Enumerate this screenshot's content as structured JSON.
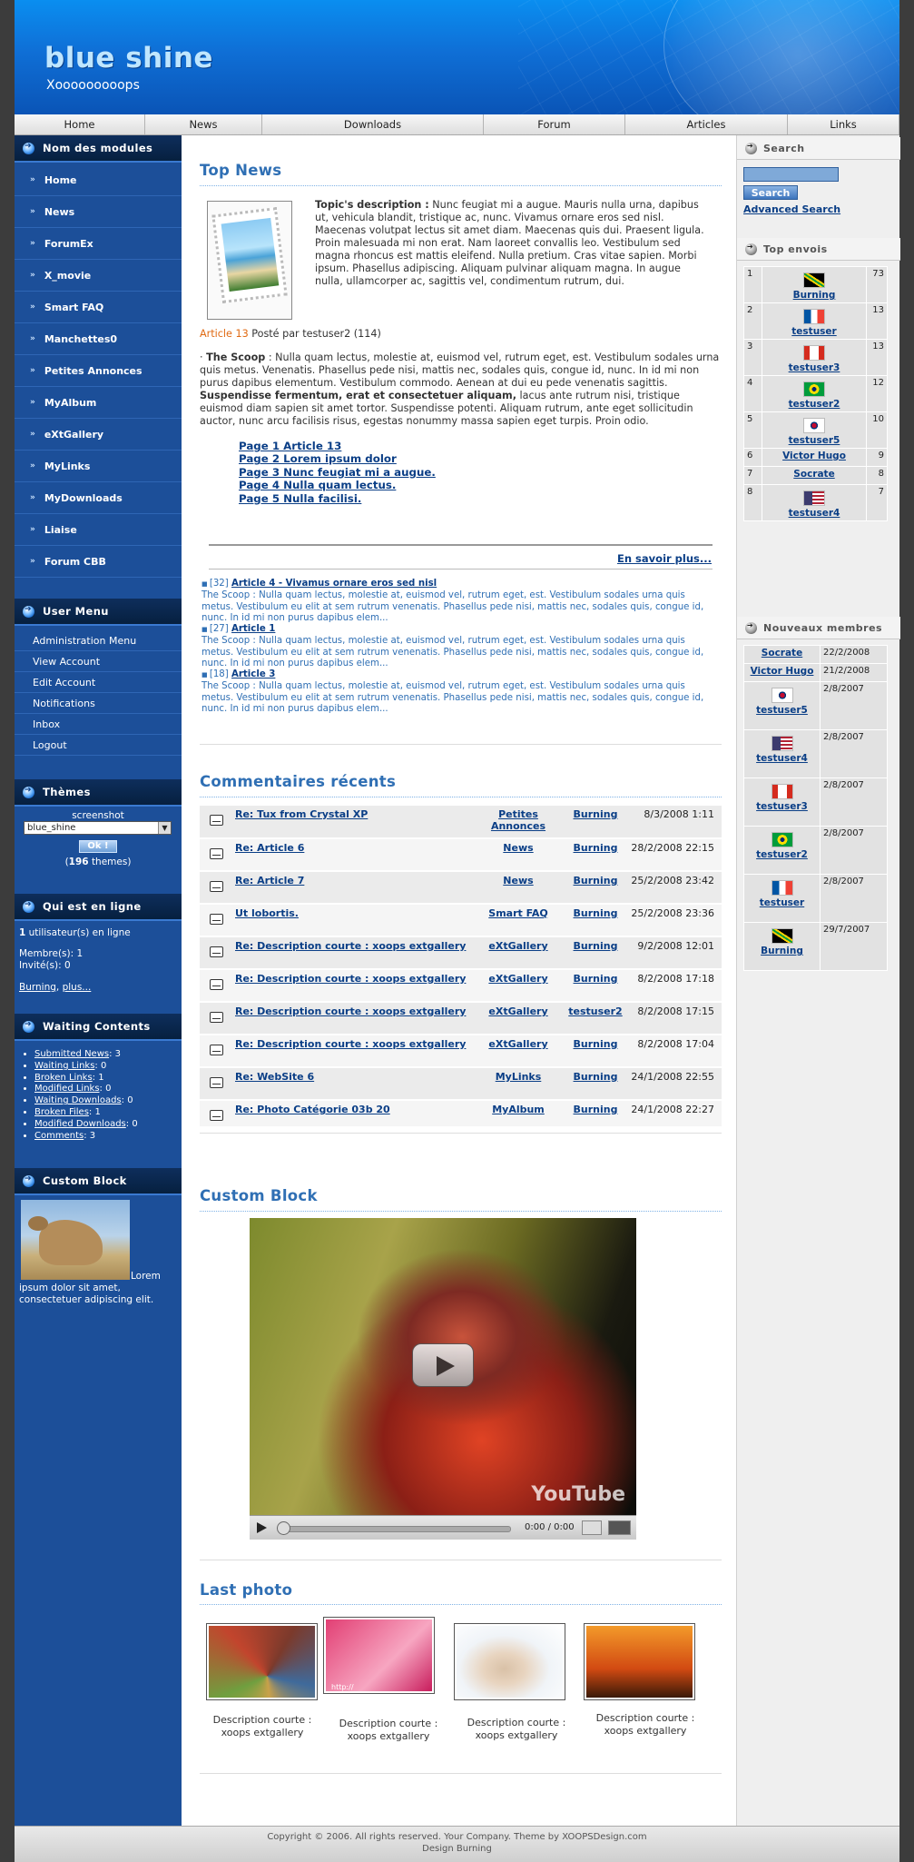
{
  "header": {
    "site_name": "blue shine",
    "slogan": "Xooooooooops"
  },
  "nav": [
    {
      "label": "Home",
      "w": 144
    },
    {
      "label": "News",
      "w": 129
    },
    {
      "label": "Downloads",
      "w": 244
    },
    {
      "label": "Forum",
      "w": 156
    },
    {
      "label": "Articles",
      "w": 179
    },
    {
      "label": "Links",
      "w": 123
    }
  ],
  "modules": {
    "title": "Nom des modules",
    "items": [
      "Home",
      "News",
      "ForumEx",
      "X_movie",
      "Smart FAQ",
      "Manchettes0",
      "Petites Annonces",
      "MyAlbum",
      "eXtGallery",
      "MyLinks",
      "MyDownloads",
      "Liaise",
      "Forum CBB"
    ]
  },
  "usermenu": {
    "title": "User Menu",
    "items": [
      "Administration Menu",
      "View Account",
      "Edit Account",
      "Notifications",
      "Inbox",
      "Logout"
    ]
  },
  "themes": {
    "title": "Thèmes",
    "screenshot_label": "screenshot",
    "selected": "blue_shine",
    "ok": "Ok !",
    "count": "196",
    "count_suffix": "themes)"
  },
  "online": {
    "title": "Qui est en ligne",
    "line1_num": "1",
    "line1": "utilisateur(s) en ligne",
    "members": "Membre(s): 1",
    "guests": "Invité(s): 0",
    "user_link": "Burning",
    "more": "plus..."
  },
  "waiting": {
    "title": "Waiting Contents",
    "items": [
      {
        "label": "Submitted News",
        "count": ": 3"
      },
      {
        "label": "Waiting Links",
        "count": ": 0"
      },
      {
        "label": "Broken Links",
        "count": ": 1"
      },
      {
        "label": "Modified Links",
        "count": ": 0"
      },
      {
        "label": "Waiting Downloads",
        "count": ": 0"
      },
      {
        "label": "Broken Files",
        "count": ": 1"
      },
      {
        "label": "Modified Downloads",
        "count": ": 0"
      },
      {
        "label": "Comments",
        "count": ": 3"
      }
    ]
  },
  "customleft": {
    "title": "Custom Block",
    "text": "Lorem ipsum dolor sit amet, consectetuer adipiscing elit."
  },
  "topnews": {
    "title": "Top News",
    "topic_label": "Topic's description :",
    "topic_text": "Nunc feugiat mi a augue. Mauris nulla urna, dapibus ut, vehicula blandit, tristique ac, nunc. Vivamus ornare eros sed nisl. Maecenas volutpat lectus sit amet diam. Maecenas quis dui. Praesent ligula. Proin malesuada mi non erat. Nam laoreet convallis leo. Vestibulum sed magna rhoncus est mattis eleifend. Nulla pretium. Cras vitae sapien. Morbi ipsum. Phasellus adipiscing. Aliquam pulvinar aliquam magna. In augue nulla, ullamcorper ac, sagittis vel, condimentum rutrum, dui.",
    "article_label": "Article 13",
    "article_meta": "Posté par testuser2 (114)",
    "scoop_label": "The Scoop",
    "scoop_text": ": Nulla quam lectus, molestie at, euismod vel, rutrum eget, est. Vestibulum sodales urna quis metus. Venenatis. Phasellus pede nisi, mattis nec, sodales quis, congue id, nunc. In id mi non purus dapibus elementum. Vestibulum commodo. Aenean at dui eu pede venenatis sagittis.",
    "scoop_bold": "Suspendisse fermentum, erat et consectetuer aliquam,",
    "scoop_text2": "lacus ante rutrum nisi, tristique euismod diam sapien sit amet tortor. Suspendisse potenti. Aliquam rutrum, ante eget sollicitudin auctor, nunc arcu facilisis risus, egestas nonummy massa sapien eget turpis. Proin odio.",
    "pages": [
      "Page 1 Article 13",
      "Page 2 Lorem ipsum dolor",
      "Page 3 Nunc feugiat mi a augue.",
      "Page 4 Nulla quam lectus.",
      "Page 5 Nulla facilisi."
    ],
    "more": "En savoir plus...",
    "list": [
      {
        "num": "[32]",
        "title": "Article 4 - Vivamus ornare eros sed nisl",
        "text": "The Scoop : Nulla quam lectus, molestie at, euismod vel, rutrum eget, est. Vestibulum sodales urna quis metus. Vestibulum eu elit at sem rutrum venenatis. Phasellus pede nisi, mattis nec, sodales quis, congue id, nunc. In id mi non purus dapibus elem..."
      },
      {
        "num": "[27]",
        "title": "Article 1",
        "text": "The Scoop : Nulla quam lectus, molestie at, euismod vel, rutrum eget, est. Vestibulum sodales urna quis metus. Vestibulum eu elit at sem rutrum venenatis. Phasellus pede nisi, mattis nec, sodales quis, congue id, nunc. In id mi non purus dapibus elem..."
      },
      {
        "num": "[18]",
        "title": "Article 3",
        "text": "The Scoop : Nulla quam lectus, molestie at, euismod vel, rutrum eget, est. Vestibulum sodales urna quis metus. Vestibulum eu elit at sem rutrum venenatis. Phasellus pede nisi, mattis nec, sodales quis, congue id, nunc. In id mi non purus dapibus elem..."
      }
    ]
  },
  "comments": {
    "title": "Commentaires récents",
    "rows": [
      {
        "title": "Re: Tux from Crystal XP",
        "module": "Petites Annonces",
        "user": "Burning",
        "date": "8/3/2008 1:11"
      },
      {
        "title": "Re: Article 6",
        "module": "News",
        "user": "Burning",
        "date": "28/2/2008 22:15"
      },
      {
        "title": "Re: Article 7",
        "module": "News",
        "user": "Burning",
        "date": "25/2/2008 23:42"
      },
      {
        "title": "Ut lobortis.",
        "module": "Smart FAQ",
        "user": "Burning",
        "date": "25/2/2008 23:36"
      },
      {
        "title": "Re: Description courte : xoops extgallery",
        "module": "eXtGallery",
        "user": "Burning",
        "date": "9/2/2008 12:01"
      },
      {
        "title": "Re: Description courte : xoops extgallery",
        "module": "eXtGallery",
        "user": "Burning",
        "date": "8/2/2008 17:18"
      },
      {
        "title": "Re: Description courte : xoops extgallery",
        "module": "eXtGallery",
        "user": "testuser2",
        "date": "8/2/2008 17:15"
      },
      {
        "title": "Re: Description courte : xoops extgallery",
        "module": "eXtGallery",
        "user": "Burning",
        "date": "8/2/2008 17:04"
      },
      {
        "title": "Re: WebSite 6",
        "module": "MyLinks",
        "user": "Burning",
        "date": "24/1/2008 22:55"
      },
      {
        "title": "Re: Photo Catégorie 03b 20",
        "module": "MyAlbum",
        "user": "Burning",
        "date": "24/1/2008 22:27"
      }
    ]
  },
  "customblock": {
    "title": "Custom Block",
    "time": "0:00 / 0:00",
    "brand": "YouTube"
  },
  "lastphoto": {
    "title": "Last photo",
    "items": [
      {
        "caption": "Description courte : xoops extgallery",
        "colors": [
          "#7b3a2c",
          "#3f6a9b",
          "#c9a14a"
        ]
      },
      {
        "caption": "Description courte : xoops extgallery",
        "colors": [
          "#e23f74",
          "#f7a6c1",
          "#c81d5c"
        ]
      },
      {
        "caption": "Description courte : xoops extgallery",
        "colors": [
          "#f0f4f8",
          "#d9c1a7",
          "#ffffff"
        ]
      },
      {
        "caption": "Description courte : xoops extgallery",
        "colors": [
          "#f39a2a",
          "#d24a12",
          "#3a1a08"
        ]
      }
    ],
    "watermark": "http://"
  },
  "search": {
    "title": "Search",
    "button": "Search",
    "advanced": "Advanced Search"
  },
  "topenvois": {
    "title": "Top envois",
    "rows": [
      {
        "rank": "1",
        "user": "Burning",
        "count": "73",
        "flag": "jm"
      },
      {
        "rank": "2",
        "user": "testuser",
        "count": "13",
        "flag": "fr"
      },
      {
        "rank": "3",
        "user": "testuser3",
        "count": "13",
        "flag": "ca"
      },
      {
        "rank": "4",
        "user": "testuser2",
        "count": "12",
        "flag": "br"
      },
      {
        "rank": "5",
        "user": "testuser5",
        "count": "10",
        "flag": "kr"
      },
      {
        "rank": "6",
        "user": "Victor Hugo",
        "count": "9",
        "flag": ""
      },
      {
        "rank": "7",
        "user": "Socrate",
        "count": "8",
        "flag": ""
      },
      {
        "rank": "8",
        "user": "testuser4",
        "count": "7",
        "flag": "us"
      }
    ]
  },
  "newmembers": {
    "title": "Nouveaux membres",
    "rows": [
      {
        "user": "Socrate",
        "date": "22/2/2008",
        "flag": ""
      },
      {
        "user": "Victor Hugo",
        "date": "21/2/2008",
        "flag": ""
      },
      {
        "user": "testuser5",
        "date": "2/8/2007",
        "flag": "kr"
      },
      {
        "user": "testuser4",
        "date": "2/8/2007",
        "flag": "us"
      },
      {
        "user": "testuser3",
        "date": "2/8/2007",
        "flag": "ca"
      },
      {
        "user": "testuser2",
        "date": "2/8/2007",
        "flag": "br"
      },
      {
        "user": "testuser",
        "date": "2/8/2007",
        "flag": "fr"
      },
      {
        "user": "Burning",
        "date": "29/7/2007",
        "flag": "jm"
      }
    ]
  },
  "footer": {
    "line1": "Copyright © 2006. All rights reserved. Your Company. Theme by XOOPSDesign.com",
    "line2": "Design Burning"
  }
}
